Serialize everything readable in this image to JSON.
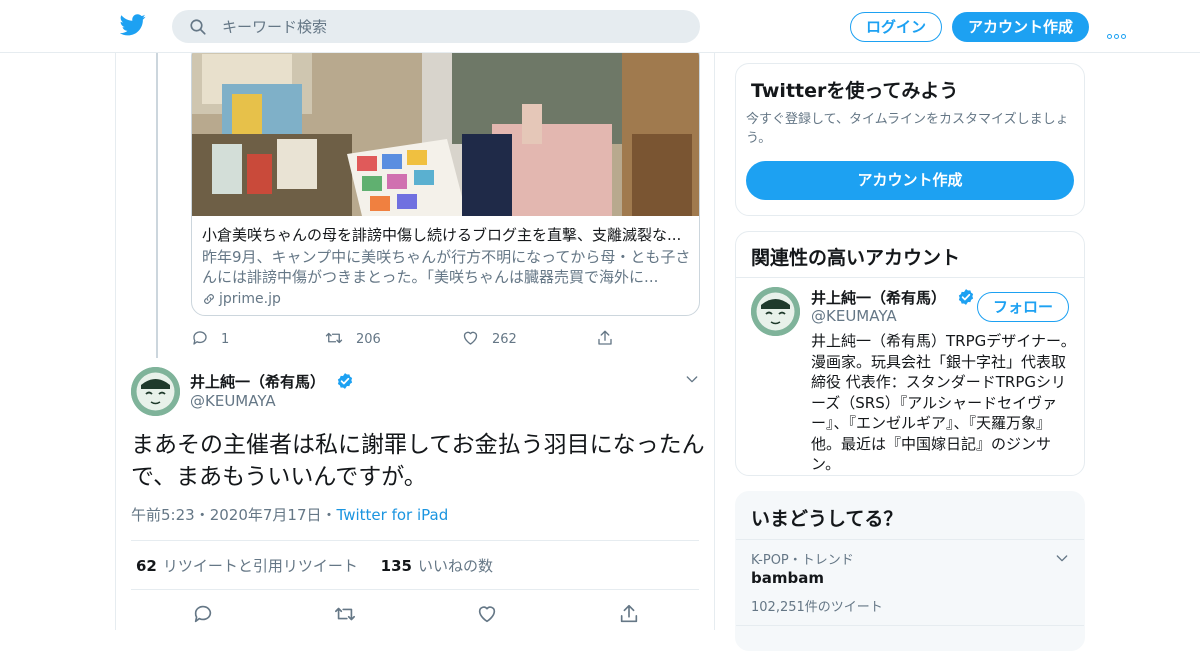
{
  "header": {
    "search_placeholder": "キーワード検索",
    "login_label": "ログイン",
    "signup_label": "アカウント作成"
  },
  "card": {
    "title": "小倉美咲ちゃんの母を誹謗中傷し続けるブログ主を直撃、支離滅裂な...",
    "description": "昨年9月、キャンプ中に美咲ちゃんが行方不明になってから母・とも子さんには誹謗中傷がつきまとった。「美咲ちゃんは臓器売買で海外に...",
    "domain": "jprime.jp"
  },
  "prev_actions": {
    "replies": "1",
    "retweets": "206",
    "likes": "262"
  },
  "tweet": {
    "author_name": "井上純一（希有馬）",
    "author_handle": "@KEUMAYA",
    "text": "まあその主催者は私に謝罪してお金払う羽目になったんで、まあもういいんですが。",
    "time": "午前5:23",
    "dot1": "・",
    "date": "2020年7月17日",
    "dot2": "・",
    "source": "Twitter for iPad",
    "retweet_count": "62",
    "retweet_label": "リツイートと引用リツイート",
    "like_count": "135",
    "like_label": "いいねの数"
  },
  "sidebar": {
    "try_title": "Twitterを使ってみよう",
    "try_sub": "今すぐ登録して、タイムラインをカスタマイズしましょう。",
    "try_button": "アカウント作成",
    "related_title": "関連性の高いアカウント",
    "related_name": "井上純一（希有馬）",
    "related_handle": "@KEUMAYA",
    "follow_label": "フォロー",
    "related_bio": "井上純一（希有馬）TRPGデザイナー。漫画家。玩具会社「銀十字社」代表取締役 代表作：スタンダードTRPGシリーズ（SRS）『アルシャードセイヴァー』、『エンゼルギア』、『天羅万象』他。最近は『中国嫁日記』のジンサン。",
    "trends_title": "いまどうしてる？",
    "trend_context": "K-POP・トレンド",
    "trend_name": "bambam",
    "trend_count": "102,251件のツイート"
  },
  "colors": {
    "accent": "#1da1f2",
    "muted": "#657786",
    "border": "#e6ecf0"
  },
  "icons": [
    "twitter-logo-icon",
    "search-icon",
    "more-icon",
    "reply-icon",
    "retweet-icon",
    "like-icon",
    "share-icon",
    "link-icon",
    "verified-icon",
    "chevron-down-icon"
  ]
}
